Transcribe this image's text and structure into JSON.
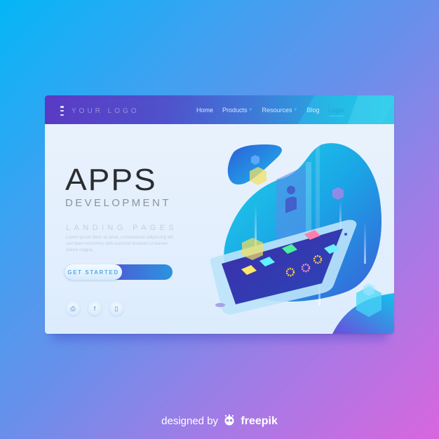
{
  "navbar": {
    "logo_text": "YOUR LOGO",
    "logo_icon": "menu-bars-icon",
    "items": [
      {
        "label": "Home",
        "dropdown": false
      },
      {
        "label": "Products",
        "dropdown": true
      },
      {
        "label": "Resources",
        "dropdown": true
      },
      {
        "label": "Blog",
        "dropdown": false
      }
    ],
    "login_label": "Login"
  },
  "hero": {
    "title": "APPS",
    "subtitle": "DEVELOPMENT",
    "tagline": "LANDING PAGES",
    "body": "Lorem ipsum dolor sit amet, consectetuer adipiscing elit, sed diam nonummy nibh euismod tincidunt ut laoreet dolore magna.",
    "cta_label": "GET STARTED"
  },
  "socials": [
    {
      "icon": "inbox-icon",
      "glyph": "⎙"
    },
    {
      "icon": "facebook-icon",
      "glyph": "f"
    },
    {
      "icon": "phone-icon",
      "glyph": "▯"
    }
  ],
  "illustration": {
    "subject": "isometric smartphone with app tiles, gears, user profile card and floating cubes",
    "tile_colors": [
      "#ffe866",
      "#5ff2ff",
      "#4bf09c",
      "#ff7fa8",
      "#6ef0ff"
    ]
  },
  "footer": {
    "credit_prefix": "designed by",
    "credit_brand": "freepik"
  },
  "colors": {
    "nav_start": "#5a3ac4",
    "nav_end": "#1fc2e4",
    "blob": "#2aa8e8",
    "background_start": "#04b6f6",
    "background_end": "#d866de"
  }
}
